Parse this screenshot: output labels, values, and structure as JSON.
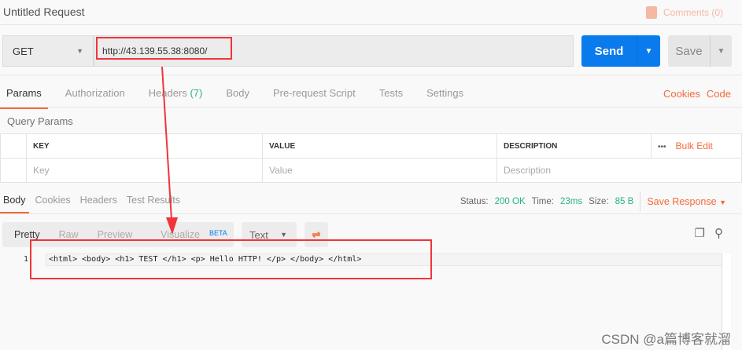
{
  "header": {
    "title": "Untitled Request",
    "comments": "Comments (0)"
  },
  "request": {
    "method": "GET",
    "url": "http://43.139.55.38:8080/",
    "send": "Send",
    "save": "Save"
  },
  "tabs": [
    {
      "label": "Params"
    },
    {
      "label": "Authorization"
    },
    {
      "label": "Headers",
      "count": "(7)"
    },
    {
      "label": "Body"
    },
    {
      "label": "Pre-request Script"
    },
    {
      "label": "Tests"
    },
    {
      "label": "Settings"
    }
  ],
  "links": {
    "cookies": "Cookies",
    "code": "Code"
  },
  "params": {
    "title": "Query Params",
    "columns": [
      "KEY",
      "VALUE",
      "DESCRIPTION"
    ],
    "more": "•••",
    "bulk_edit": "Bulk Edit",
    "placeholders": [
      "Key",
      "Value",
      "Description"
    ]
  },
  "response": {
    "tabs": [
      "Body",
      "Cookies",
      "Headers",
      "Test Results"
    ],
    "status_label": "Status:",
    "status": "200 OK",
    "time_label": "Time:",
    "time": "23ms",
    "size_label": "Size:",
    "size": "85 B",
    "save_response": "Save Response",
    "views": [
      "Pretty",
      "Raw",
      "Preview",
      "Visualize"
    ],
    "beta": "BETA",
    "format": "Text",
    "line_number": "1",
    "code": "<html> <body> <h1> TEST </h1> <p> Hello HTTP! </p> </body> </html>"
  },
  "annotation": {
    "color": "#f0353a",
    "arrow": "annotation-arrow"
  },
  "watermark": "CSDN @a篇博客就溜",
  "colors": {
    "accent": "#f26b3a",
    "send": "#097bed",
    "success": "#26b47f"
  }
}
